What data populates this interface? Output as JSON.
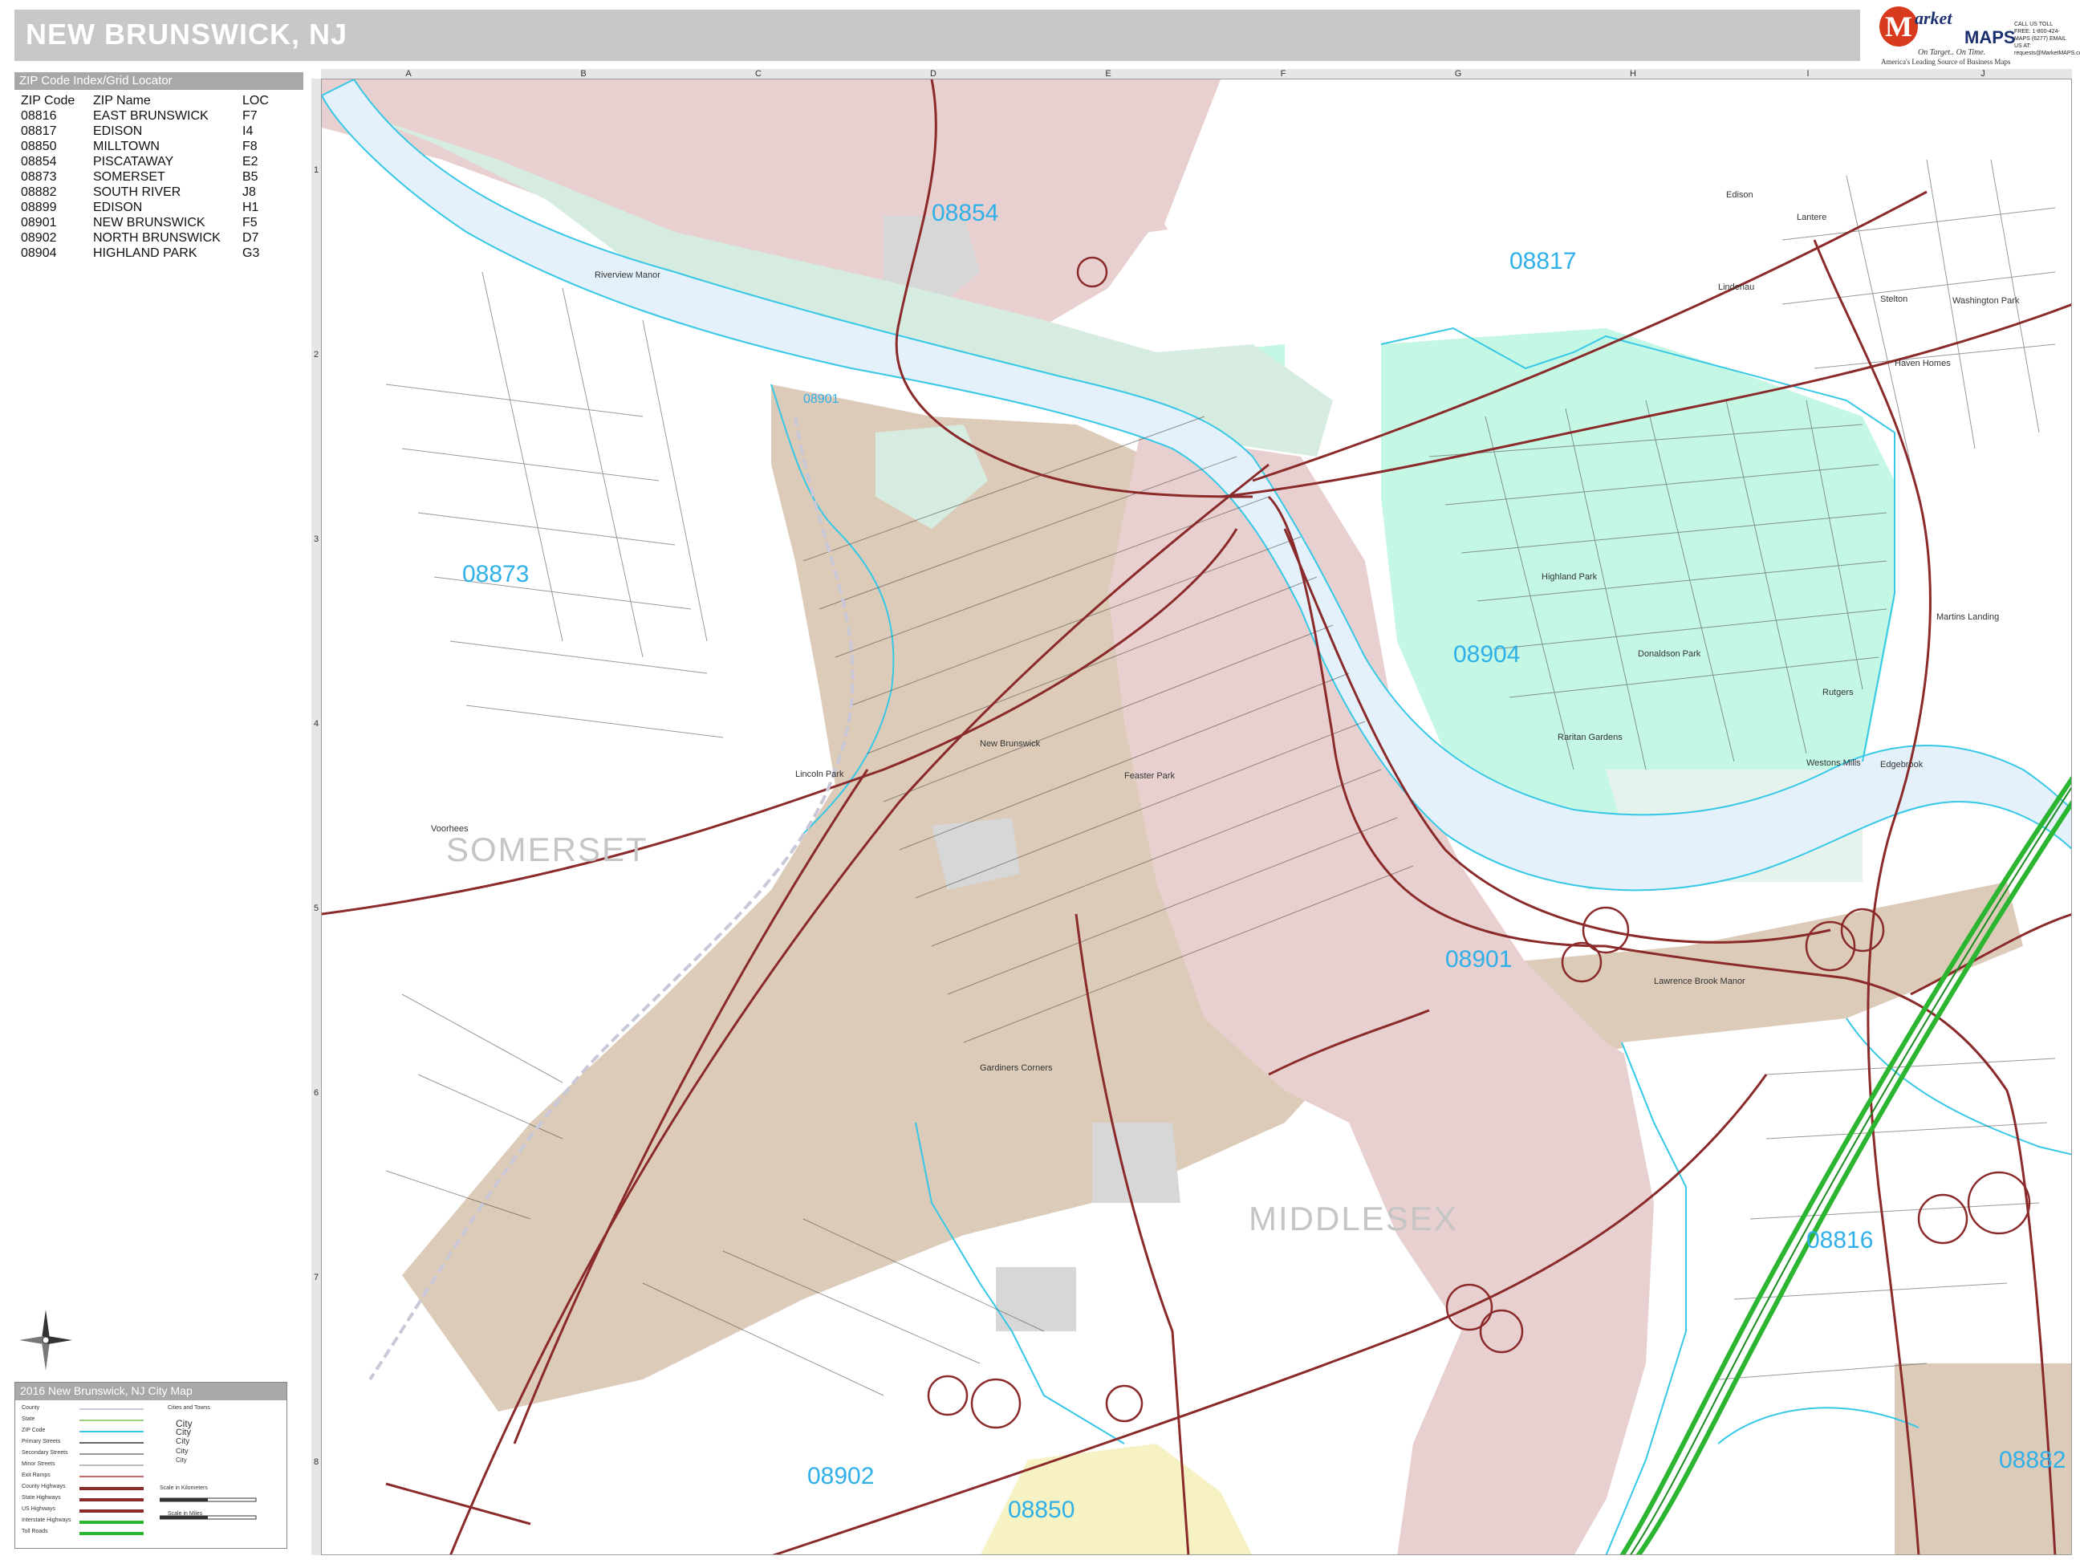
{
  "header": {
    "title": "NEW BRUNSWICK, NJ"
  },
  "brand": {
    "logo_letter": "M",
    "name_part1": "arket",
    "name_part2": "MAPS",
    "tagline": "On Target.. On Time.",
    "subtagline": "America's Leading Source of Business Maps",
    "contact": "CALL US TOLL FREE: 1-800-424-MAPS (6277) EMAIL US AT: requests@MarketMAPS.com"
  },
  "zip_index": {
    "title": "ZIP Code Index/Grid Locator",
    "columns": [
      "ZIP Code",
      "ZIP Name",
      "LOC"
    ],
    "rows": [
      [
        "08816",
        "EAST BRUNSWICK",
        "F7"
      ],
      [
        "08817",
        "EDISON",
        "I4"
      ],
      [
        "08850",
        "MILLTOWN",
        "F8"
      ],
      [
        "08854",
        "PISCATAWAY",
        "E2"
      ],
      [
        "08873",
        "SOMERSET",
        "B5"
      ],
      [
        "08882",
        "SOUTH RIVER",
        "J8"
      ],
      [
        "08899",
        "EDISON",
        "H1"
      ],
      [
        "08901",
        "NEW BRUNSWICK",
        "F5"
      ],
      [
        "08902",
        "NORTH BRUNSWICK",
        "D7"
      ],
      [
        "08904",
        "HIGHLAND PARK",
        "G3"
      ]
    ]
  },
  "grid": {
    "columns": [
      "A",
      "B",
      "C",
      "D",
      "E",
      "F",
      "G",
      "H",
      "I",
      "J"
    ],
    "rows": [
      "1",
      "2",
      "3",
      "4",
      "5",
      "6",
      "7",
      "8"
    ]
  },
  "map": {
    "zip_labels": [
      "08854",
      "08817",
      "08901",
      "08873",
      "08904",
      "08901",
      "08816",
      "08902",
      "08850",
      "08882"
    ],
    "county_labels": [
      "SOMERSET",
      "MIDDLESEX"
    ],
    "place_labels": [
      "Edison",
      "Riverview Manor",
      "Lindenau",
      "Stelton",
      "Washington Park",
      "Haven Homes",
      "Highland Park",
      "Donaldson Park",
      "Martins Landing",
      "Rutgers",
      "Raritan Gardens",
      "Westons Mills",
      "Edgebrook",
      "New Brunswick",
      "Lincoln Park",
      "Feaster Park",
      "Voorhees",
      "Lawrence Brook Manor",
      "Gardiners Corners",
      "Lantere"
    ]
  },
  "legend": {
    "title": "2016 New Brunswick, NJ City Map",
    "items": [
      "County",
      "State",
      "ZIP Code",
      "Primary Streets",
      "Secondary Streets",
      "Minor Streets",
      "Exit Ramps",
      "County Highways",
      "State Highways",
      "US Highways",
      "Interstate Highways",
      "Toll Roads"
    ],
    "cities_title": "Cities and Towns",
    "city_sizes": [
      "City",
      "City",
      "City",
      "City",
      "City"
    ],
    "scale_km": "Scale in Kilometers",
    "scale_mi": "Scale in Miles"
  },
  "colors": {
    "tan_zone": "#dccbb8",
    "pink_zone": "#e7d0cf",
    "green_zone": "#d6ece0",
    "mint_zone": "#c4f7e4",
    "yellow_zone": "#f6f2c4",
    "water": "#e4f1fa",
    "zip_border": "#36c8e6",
    "highway": "#8a2a2a",
    "interstate": "#2bb531",
    "zip_text": "#2fb0e8"
  }
}
